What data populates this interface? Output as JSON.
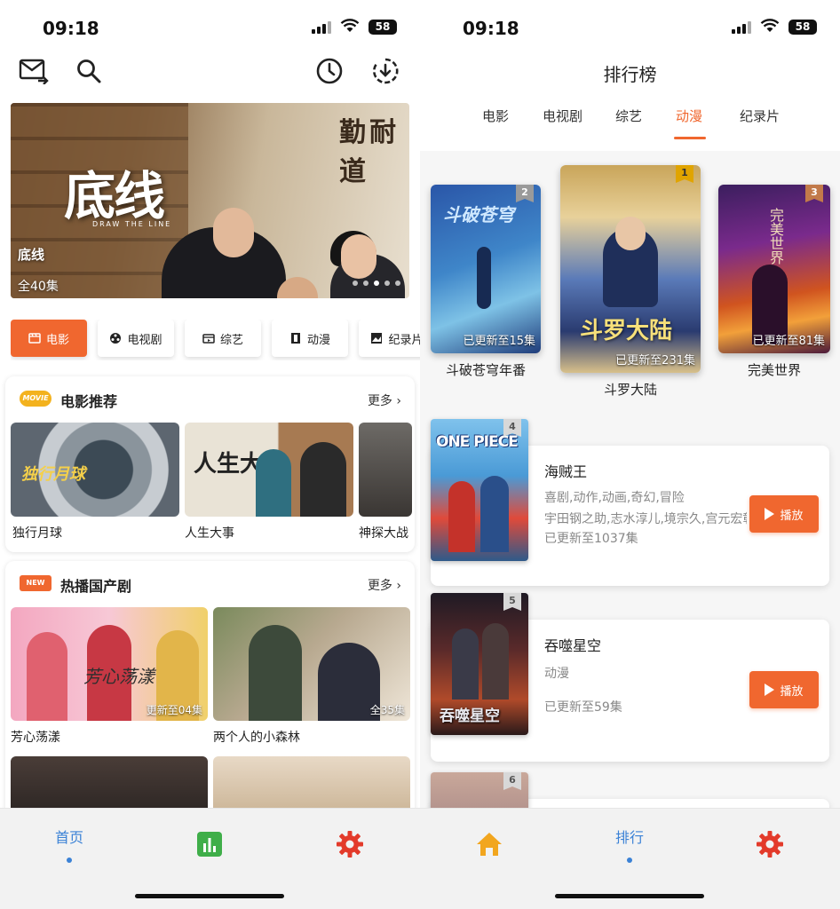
{
  "status": {
    "time": "09:18",
    "battery": "58"
  },
  "colors": {
    "accent": "#f0672f",
    "tab_active": "#3b82d6",
    "tab_rank_icon": "#3fae49"
  },
  "left": {
    "icons": [
      "mail-share-icon",
      "search-icon",
      "history-clock-icon",
      "download-icon"
    ],
    "banner": {
      "art_title": "底线",
      "art_subtitle": "DRAW THE LINE",
      "art_calligraphy": "勤耐道",
      "name": "底线",
      "episodes": "全40集",
      "dots": 5,
      "active_dot": 2
    },
    "categories": [
      {
        "label": "电影",
        "icon": "movie-icon",
        "active": true
      },
      {
        "label": "电视剧",
        "icon": "tv-icon",
        "active": false
      },
      {
        "label": "综艺",
        "icon": "variety-icon",
        "active": false
      },
      {
        "label": "动漫",
        "icon": "film-strip-icon",
        "active": false
      },
      {
        "label": "纪录片",
        "icon": "image-icon",
        "active": false
      }
    ],
    "movies": {
      "badge": "MOVIE",
      "title": "电影推荐",
      "more": "更多",
      "items": [
        {
          "title": "独行月球",
          "art": "独行月球"
        },
        {
          "title": "人生大事",
          "art": "人生大事"
        },
        {
          "title": "神探大战",
          "art": ""
        }
      ]
    },
    "dramas": {
      "badge": "NEW",
      "title": "热播国产剧",
      "more": "更多",
      "items": [
        {
          "title": "芳心荡漾",
          "tag": "更新至04集",
          "art": "芳心荡漾"
        },
        {
          "title": "两个人的小森林",
          "tag": "全35集",
          "art": ""
        }
      ]
    },
    "tabs": [
      {
        "label": "首页",
        "icon": "home-icon"
      },
      {
        "label": "",
        "icon": "chart-icon"
      },
      {
        "label": "",
        "icon": "settings-gear-icon"
      }
    ]
  },
  "right": {
    "title": "排行榜",
    "tabs": [
      "电影",
      "电视剧",
      "综艺",
      "动漫",
      "纪录片"
    ],
    "active_tab": "动漫",
    "podium": [
      {
        "rank": "2",
        "title": "斗破苍穹年番",
        "tag": "已更新至15集",
        "art": "斗破苍穹"
      },
      {
        "rank": "1",
        "title": "斗罗大陆",
        "tag": "已更新至231集",
        "art": "斗罗大陆"
      },
      {
        "rank": "3",
        "title": "完美世界",
        "tag": "已更新至81集",
        "art": "完美世界"
      }
    ],
    "list": [
      {
        "rank": "4",
        "title": "海贼王",
        "genres": "喜剧,动作,动画,奇幻,冒险",
        "cast": "宇田钢之助,志水淳儿,境宗久,宫元宏彰",
        "status": "已更新至1037集",
        "play": "播放",
        "art": "ONE PIECE"
      },
      {
        "rank": "5",
        "title": "吞噬星空",
        "genres": "动漫",
        "cast": "",
        "status": "已更新至59集",
        "play": "播放",
        "art": "吞噬星空"
      },
      {
        "rank": "6",
        "title": "",
        "genres": "",
        "cast": "",
        "status": "",
        "play": "",
        "art": ""
      }
    ],
    "tabs_bottom": [
      {
        "label": "",
        "icon": "home-icon"
      },
      {
        "label": "排行",
        "icon": "chart-icon"
      },
      {
        "label": "",
        "icon": "settings-gear-icon"
      }
    ]
  }
}
